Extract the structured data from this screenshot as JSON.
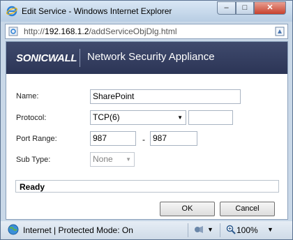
{
  "window": {
    "title": "Edit Service - Windows Internet Explorer",
    "controls": {
      "minimize": "–",
      "maximize": "□",
      "close": "✕"
    }
  },
  "address": {
    "url_prefix": "http://",
    "url_host": "192.168.1.2",
    "url_path": "/addServiceObjDlg.html"
  },
  "banner": {
    "logo": "SONICWALL",
    "product": "Network Security Appliance"
  },
  "form": {
    "name_label": "Name:",
    "name_value": "SharePoint",
    "protocol_label": "Protocol:",
    "protocol_value": "TCP(6)",
    "protocol_number": "",
    "port_range_label": "Port Range:",
    "port_start": "987",
    "port_separator": "-",
    "port_end": "987",
    "subtype_label": "Sub Type:",
    "subtype_value": "None"
  },
  "status": {
    "text": "Ready"
  },
  "buttons": {
    "ok": "OK",
    "cancel": "Cancel"
  },
  "ie_status": {
    "zone": "Internet | Protected Mode: On",
    "zoom": "100%"
  }
}
